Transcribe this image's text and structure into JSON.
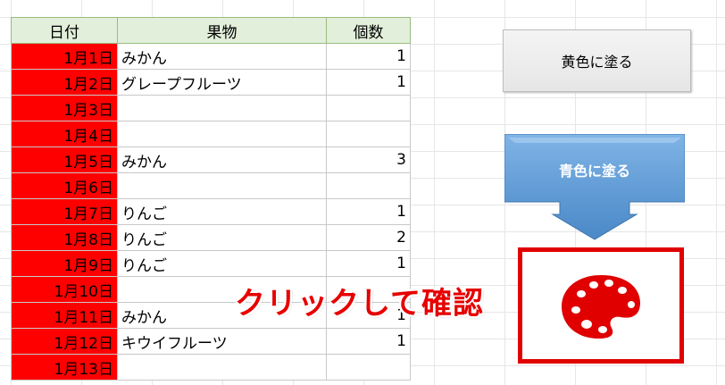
{
  "table": {
    "headers": [
      "日付",
      "果物",
      "個数"
    ],
    "rows": [
      {
        "date": "1月1日",
        "fruit": "みかん",
        "count": "1"
      },
      {
        "date": "1月2日",
        "fruit": "グレープフルーツ",
        "count": "1"
      },
      {
        "date": "1月3日",
        "fruit": "",
        "count": ""
      },
      {
        "date": "1月4日",
        "fruit": "",
        "count": ""
      },
      {
        "date": "1月5日",
        "fruit": "みかん",
        "count": "3"
      },
      {
        "date": "1月6日",
        "fruit": "",
        "count": ""
      },
      {
        "date": "1月7日",
        "fruit": "りんご",
        "count": "1"
      },
      {
        "date": "1月8日",
        "fruit": "りんご",
        "count": "2"
      },
      {
        "date": "1月9日",
        "fruit": "りんご",
        "count": "1"
      },
      {
        "date": "1月10日",
        "fruit": "",
        "count": ""
      },
      {
        "date": "1月11日",
        "fruit": "みかん",
        "count": "1"
      },
      {
        "date": "1月12日",
        "fruit": "キウイフルーツ",
        "count": "1"
      },
      {
        "date": "1月13日",
        "fruit": "",
        "count": ""
      }
    ]
  },
  "buttons": {
    "yellow_label": "黄色に塗る",
    "blue_label": "青色に塗る"
  },
  "annotation": "クリックして確認",
  "colors": {
    "date_fill": "#ff0000",
    "header_fill": "#e2efda",
    "blue_button": "#5b9bd5",
    "highlight_border": "#e00000"
  },
  "icons": {
    "palette": "paint-palette-icon",
    "arrow": "down-arrow-icon"
  }
}
